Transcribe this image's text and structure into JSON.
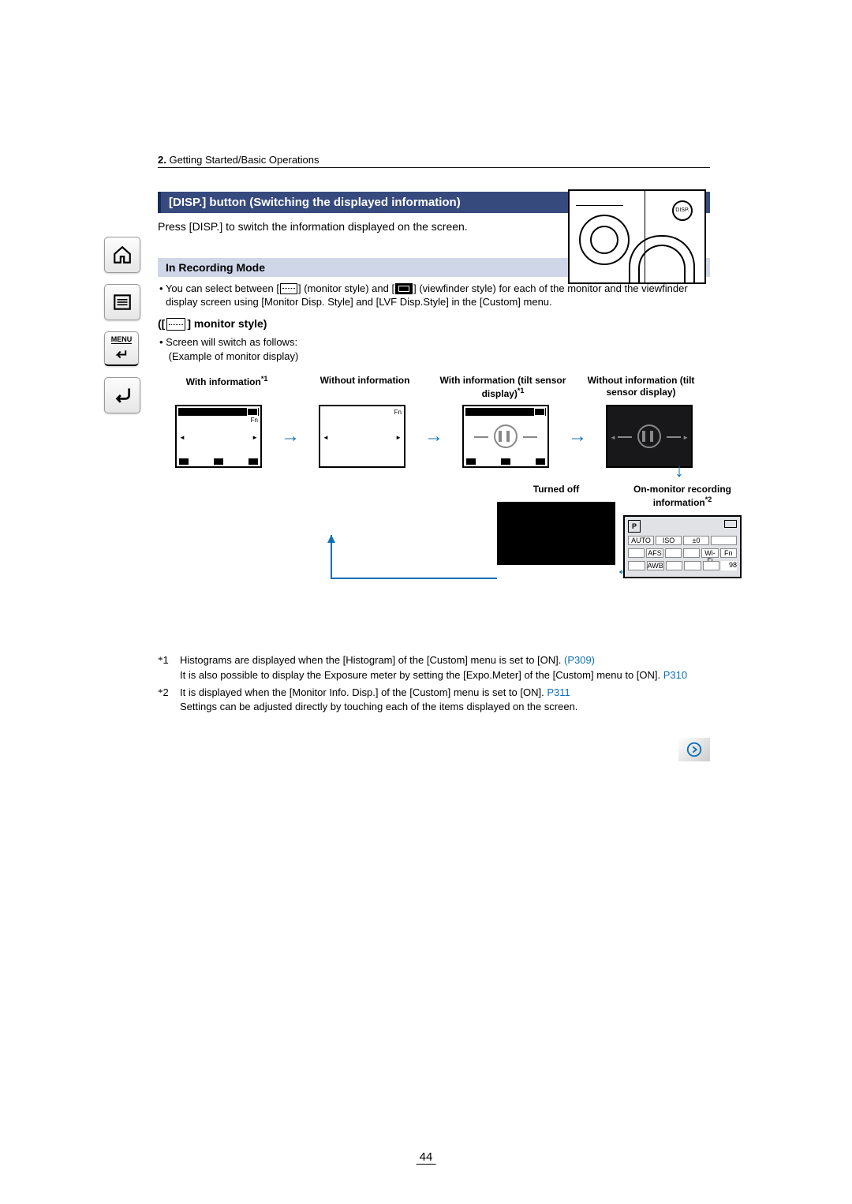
{
  "breadcrumb": {
    "num": "2.",
    "text": "Getting Started/Basic Operations"
  },
  "title": "[DISP.] button (Switching the displayed information)",
  "intro": "Press [DISP.] to switch the information displayed on the screen.",
  "camera_button_label": "DISP.",
  "sub1": "In Recording Mode",
  "bullet1_a": "• You can select between [",
  "bullet1_b": "] (monitor style) and [",
  "bullet1_c": "] (viewfinder style) for each of the monitor and the viewfinder display screen using [Monitor Disp. Style] and [LVF Disp.Style] in the [Custom] menu.",
  "subsub_a": "([",
  "subsub_b": "] monitor style)",
  "bullet2": "• Screen will switch as follows:",
  "bullet2b": "Example of monitor display)",
  "labels": {
    "col1": {
      "t": "With information",
      "sup": "*1"
    },
    "col2": {
      "t": "Without information"
    },
    "col3": {
      "t": "With information (tilt sensor display)",
      "sup": "*1"
    },
    "col4": {
      "t": "Without information (tilt sensor display)"
    }
  },
  "row2": {
    "turned": "Turned off",
    "onmon": {
      "t": "On-monitor recording information",
      "sup": "*2"
    },
    "info_badges": {
      "p": "P",
      "auto": "AUTO",
      "iso": "ISO",
      "ev": "±0",
      "afs": "AFS",
      "awb": "AWB",
      "wifi": "Wi-Fi",
      "fn": "Fn",
      "count": "98"
    }
  },
  "footnotes": {
    "f1": {
      "mark": "*1",
      "text": "Histograms are displayed when the [Histogram] of the [Custom] menu is set to [ON]. ",
      "link": "(P309)",
      "text2": "It is also possible to display the Exposure meter by setting the [Expo.Meter] of the [Custom] menu to [ON]. ",
      "link2": "P310"
    },
    "f2": {
      "mark": "*2",
      "text": "It is displayed when the [Monitor Info. Disp.] of the [Custom] menu is set to [ON]. ",
      "link": "P311",
      "text2": "Settings can be adjusted directly by touching each of the items displayed on the screen."
    }
  },
  "page_number": "44",
  "sidebar": {
    "home": "home-icon",
    "toc": "toc-icon",
    "menu": "MENU",
    "back": "back-icon"
  }
}
